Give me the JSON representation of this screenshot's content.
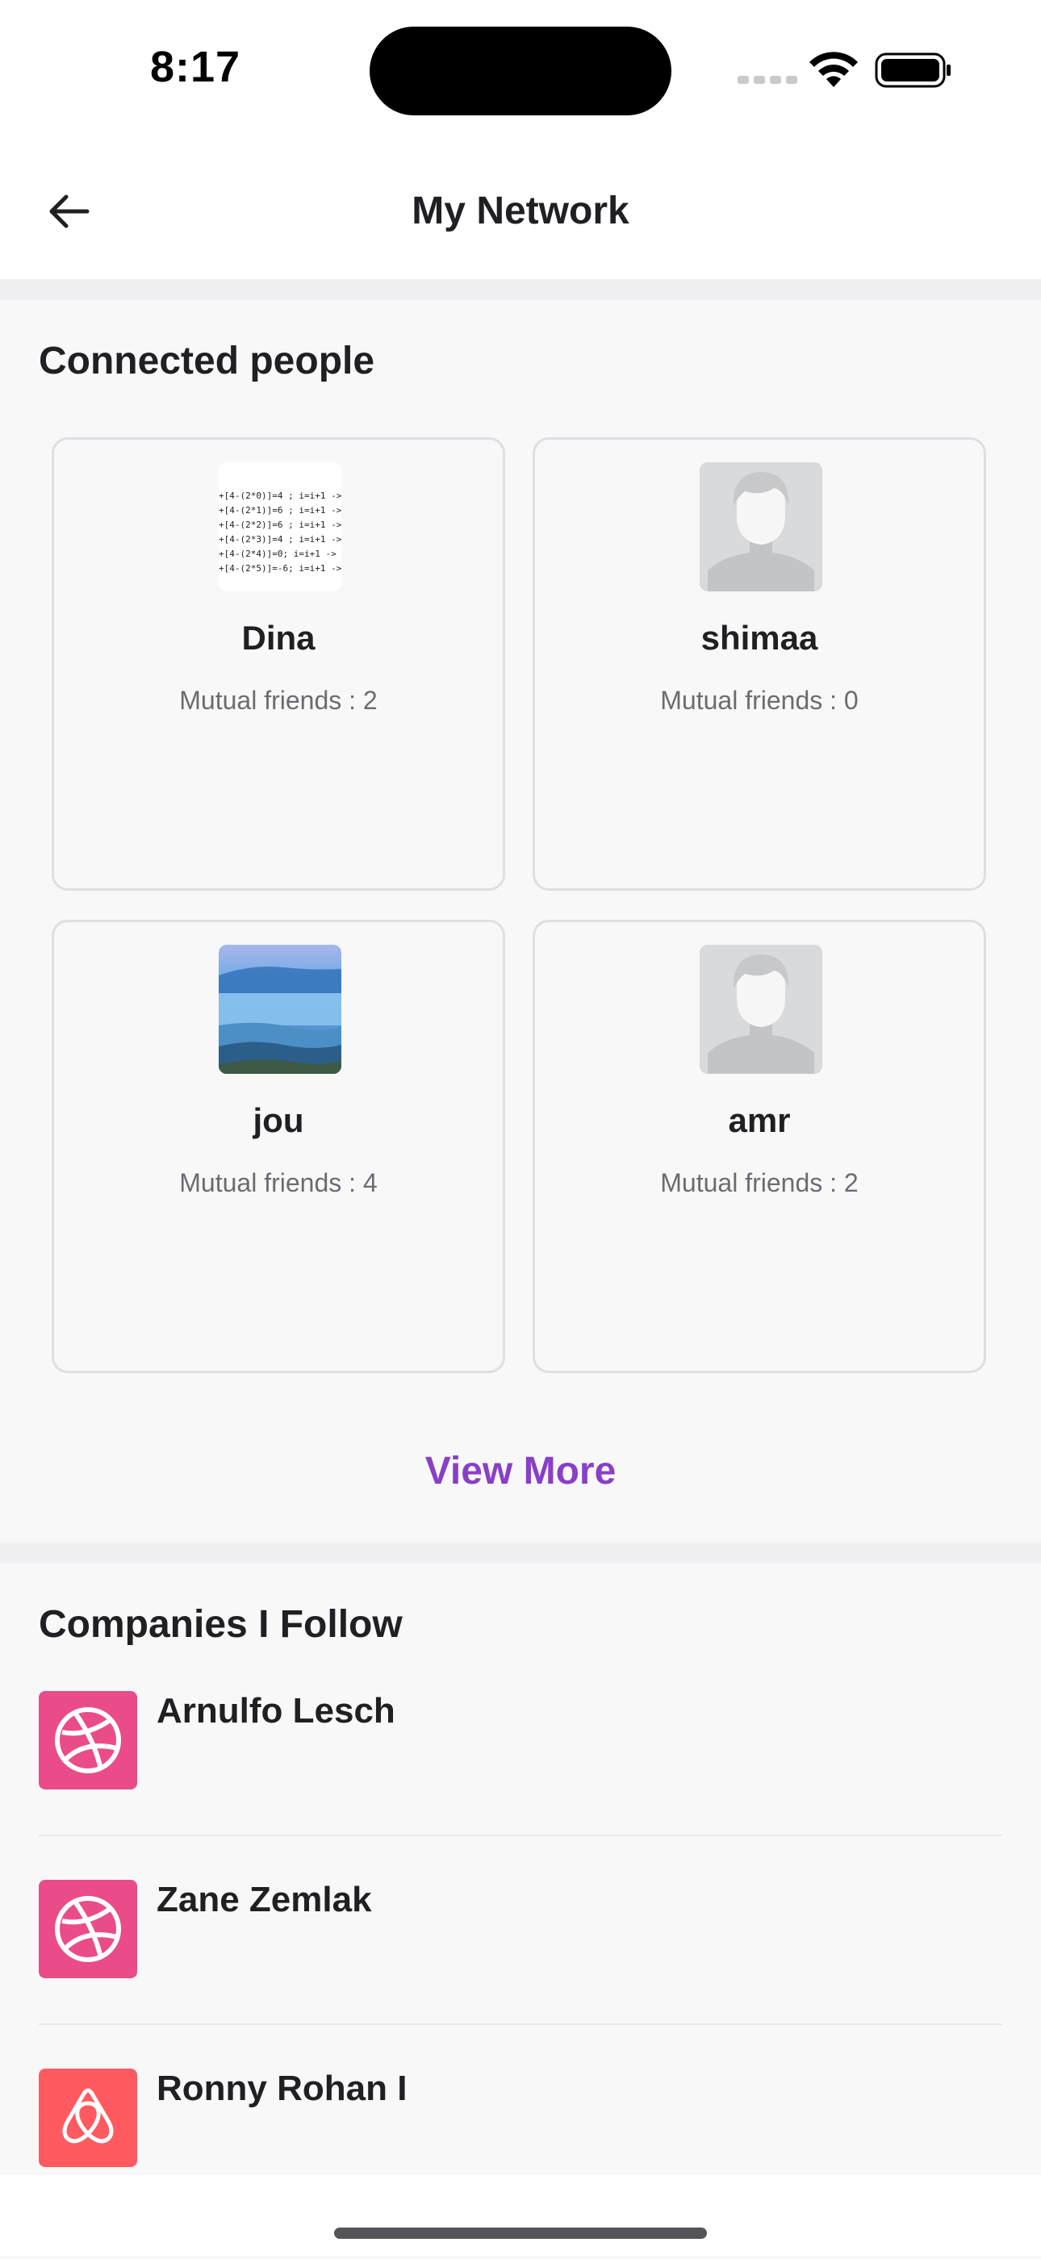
{
  "status_bar": {
    "time": "8:17"
  },
  "nav": {
    "title": "My Network",
    "back_icon": "arrow-left-icon"
  },
  "connected": {
    "title": "Connected people",
    "mutual_label": "Mutual friends",
    "people": [
      {
        "name": "Dina",
        "mutual_text": "Mutual friends  : 2",
        "avatar": "code-snippet-photo"
      },
      {
        "name": "shimaa",
        "mutual_text": "Mutual friends  : 0",
        "avatar": "default-person-avatar"
      },
      {
        "name": "jou",
        "mutual_text": "Mutual friends  : 4",
        "avatar": "landscape-photo"
      },
      {
        "name": "amr",
        "mutual_text": "Mutual friends  : 2",
        "avatar": "default-person-avatar"
      }
    ],
    "view_more": "View More"
  },
  "companies": {
    "title": "Companies I Follow",
    "items": [
      {
        "name": "Arnulfo Lesch",
        "logo": "dribbble-icon",
        "color": "#ea4c89"
      },
      {
        "name": "Zane Zemlak",
        "logo": "dribbble-icon",
        "color": "#ea4c89"
      },
      {
        "name": "Ronny Rohan I",
        "logo": "airbnb-icon",
        "color": "#ff5a5f"
      }
    ]
  },
  "colors": {
    "accent": "#8a3fc7",
    "background": "#f8f8f9",
    "divider": "#eef0f4"
  }
}
